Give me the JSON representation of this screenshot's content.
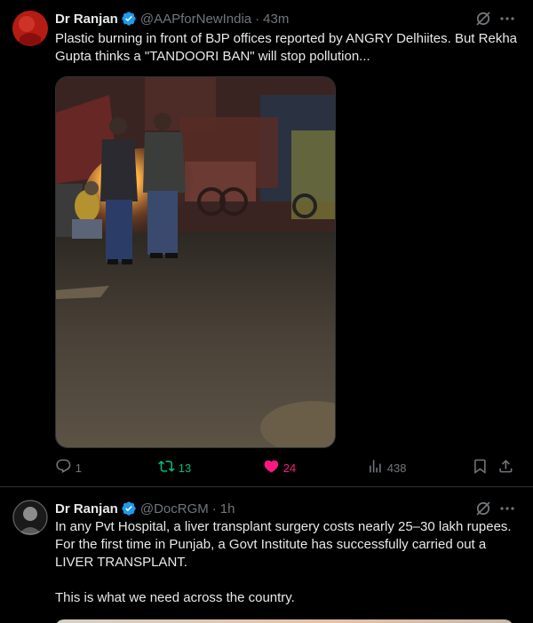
{
  "tweets": [
    {
      "author_name": "Dr Ranjan",
      "handle": "@AAPforNewIndia",
      "separator": "·",
      "time": "43m",
      "text": "Plastic burning in front of BJP offices reported by ANGRY Delhiites. But Rekha Gupta thinks a \"TANDOORI BAN\" will stop pollution...",
      "media_alt": "Night street scene: men standing near a roadside fire beside parked rickshaws",
      "stats": {
        "replies": "1",
        "retweets": "13",
        "likes": "24",
        "views": "438"
      },
      "colors": {
        "retweet_active": "#00ba7c",
        "like_active": "#f91880",
        "muted": "#71767b"
      }
    },
    {
      "author_name": "Dr Ranjan",
      "handle": "@DocRGM",
      "separator": "·",
      "time": "1h",
      "text": "In any Pvt Hospital, a liver transplant surgery costs nearly 25–30 lakh rupees. For the first time in Punjab, a Govt Institute has successfully carried out a LIVER TRANSPLANT.\n\nThis is what we need across the country."
    }
  ],
  "icons": {
    "verified": "verified-badge-icon",
    "grok": "grok-icon",
    "more": "more-icon",
    "reply": "reply-icon",
    "retweet": "retweet-icon",
    "like": "heart-icon",
    "views": "views-icon",
    "bookmark": "bookmark-icon",
    "share": "share-icon"
  },
  "theme": {
    "background": "#000000",
    "border": "#2f3336",
    "text": "#e7e9ea",
    "accent": "#1d9bf0"
  }
}
